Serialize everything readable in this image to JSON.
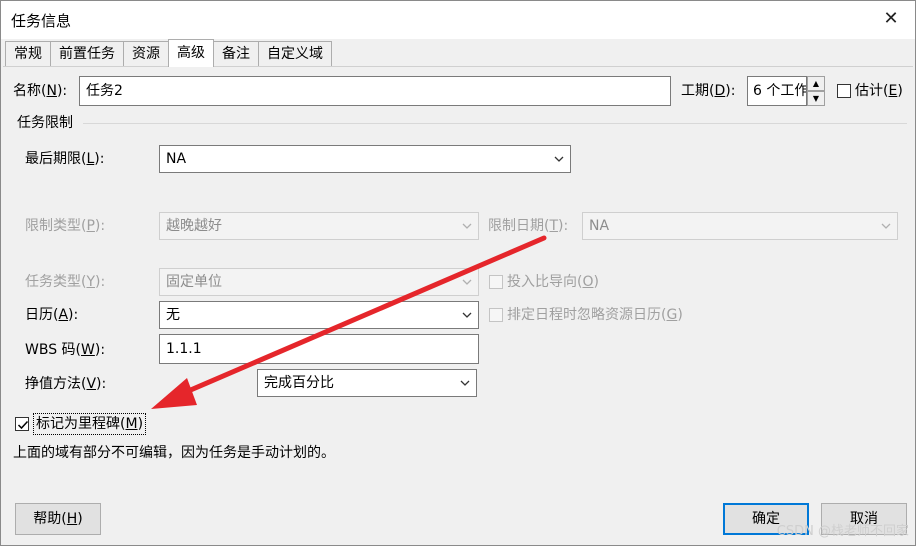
{
  "window": {
    "title": "任务信息",
    "close_glyph": "✕"
  },
  "tabs": [
    {
      "label": "常规"
    },
    {
      "label": "前置任务"
    },
    {
      "label": "资源"
    },
    {
      "label": "高级"
    },
    {
      "label": "备注"
    },
    {
      "label": "自定义域"
    }
  ],
  "name_field": {
    "label": "名称",
    "key": "N",
    "value": "任务2"
  },
  "duration": {
    "label": "工期",
    "key": "D",
    "value": "6 个工作"
  },
  "estimate": {
    "label": "估计",
    "key": "E",
    "checked": false
  },
  "constraints_group": {
    "title": "任务限制"
  },
  "deadline": {
    "label": "最后期限",
    "key": "L",
    "value": "NA"
  },
  "constraint_type": {
    "label": "限制类型",
    "key": "P",
    "value": "越晚越好"
  },
  "constraint_date": {
    "label": "限制日期",
    "key": "T",
    "value": "NA"
  },
  "task_type": {
    "label": "任务类型",
    "key": "Y",
    "value": "固定单位"
  },
  "effort_driven": {
    "label": "投入比导向",
    "key": "O"
  },
  "calendar": {
    "label": "日历",
    "key": "A",
    "value": "无"
  },
  "ignore_resource_calendar": {
    "label": "排定日程时忽略资源日历",
    "key": "G"
  },
  "wbs": {
    "label": "WBS 码",
    "key": "W",
    "value": "1.1.1"
  },
  "earned_value": {
    "label": "挣值方法",
    "key": "V",
    "value": "完成百分比"
  },
  "milestone": {
    "label": "标记为里程碑",
    "key": "M",
    "checked": true
  },
  "note": "上面的域有部分不可编辑，因为任务是手动计划的。",
  "buttons": {
    "help": "帮助",
    "help_key": "H",
    "ok": "确定",
    "cancel": "取消"
  },
  "watermark": "CSDN @栈老师不回家",
  "colors": {
    "accent": "#0078d7",
    "annotation_arrow": "#e5262b"
  }
}
